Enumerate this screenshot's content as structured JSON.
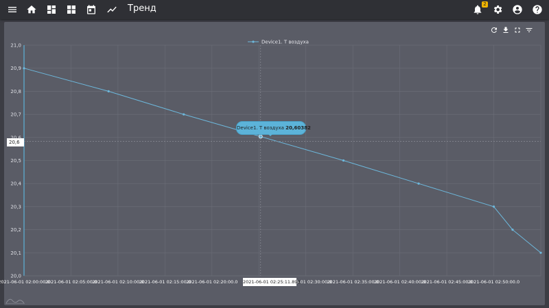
{
  "header": {
    "title": "Тренд",
    "notification_count": "2",
    "icons": [
      "menu-icon",
      "home-icon",
      "dashboard-icon",
      "widgets-icon",
      "calendar-icon",
      "trend-icon",
      "bell-icon",
      "gear-icon",
      "account-icon",
      "help-icon"
    ]
  },
  "toolbar": {
    "icons": [
      "refresh-icon",
      "download-icon",
      "fullscreen-icon",
      "filter-icon"
    ]
  },
  "tooltip": {
    "series": "Device1. Т воздуха",
    "value": "20,60382"
  },
  "crosshair": {
    "y_label": "20,6",
    "x_label": "2021-06-01 02:25:11.893"
  },
  "colors": {
    "accent": "#5cb3d9",
    "line": "#6db8dc",
    "panel": "#5a5c66",
    "header": "#2f3035"
  },
  "chart_data": {
    "type": "line",
    "legend_position": "top-center",
    "grid": true,
    "x_tick_labels": [
      "2021-06-01 02:00:00.0",
      "2021-06-01 02:05:00.0",
      "2021-06-01 02:10:00.0",
      "2021-06-01 02:15:00.0",
      "2021-06-01 02:20:00.0",
      "2021-06-01 02:30:00.0",
      "2021-06-01 02:35:00.0",
      "2021-06-01 02:40:00.0",
      "2021-06-01 02:45:00.0",
      "2021-06-01 02:50:00.0"
    ],
    "x_tick_minutes": [
      0,
      5,
      10,
      15,
      20,
      30,
      35,
      40,
      45,
      50
    ],
    "x_range": [
      "2021-06-01 02:00:00.0",
      "2021-06-01 02:55:00.0"
    ],
    "y_tick_labels": [
      "21,0",
      "20,9",
      "20,8",
      "20,7",
      "20,6",
      "20,5",
      "20,4",
      "20,3",
      "20,2",
      "20,1",
      "20,0"
    ],
    "ylim": [
      20.0,
      21.0
    ],
    "series": [
      {
        "name": "Device1. Т воздуха",
        "x": [
          "2021-06-01 02:00:00",
          "2021-06-01 02:09:00",
          "2021-06-01 02:17:00",
          "2021-06-01 02:25:11",
          "2021-06-01 02:34:00",
          "2021-06-01 02:42:00",
          "2021-06-01 02:50:00",
          "2021-06-01 02:52:00",
          "2021-06-01 02:55:00"
        ],
        "y": [
          20.9,
          20.8,
          20.7,
          20.60382,
          20.5,
          20.4,
          20.3,
          20.2,
          20.1
        ]
      }
    ]
  }
}
